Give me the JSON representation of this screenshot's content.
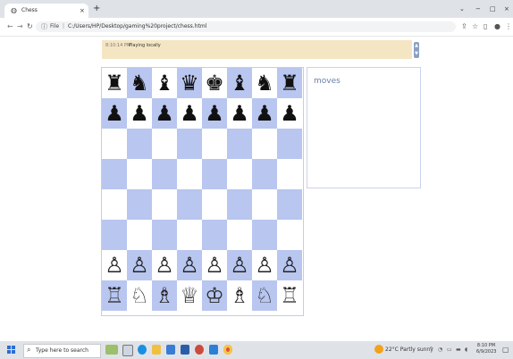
{
  "browser": {
    "tab_title": "Chess",
    "tab_icon": "globe-icon",
    "new_tab_glyph": "+",
    "url_prefix": "File",
    "url": "C:/Users/HP/Desktop/gaming%20project/chess.html",
    "controls": {
      "minimize": "−",
      "maximize": "□",
      "close": "×",
      "tabs_down": "⌄"
    }
  },
  "status": {
    "time": "8:10:14 PM",
    "message": "Playing locally"
  },
  "moves_panel": {
    "label": "moves"
  },
  "board": {
    "light_color": "#ffffff",
    "dark_color": "#b8c6f0",
    "rows": [
      [
        "♜",
        "♞",
        "♝",
        "♛",
        "♚",
        "♝",
        "♞",
        "♜"
      ],
      [
        "♟",
        "♟",
        "♟",
        "♟",
        "♟",
        "♟",
        "♟",
        "♟"
      ],
      [
        "",
        "",
        "",
        "",
        "",
        "",
        "",
        ""
      ],
      [
        "",
        "",
        "",
        "",
        "",
        "",
        "",
        ""
      ],
      [
        "",
        "",
        "",
        "",
        "",
        "",
        "",
        ""
      ],
      [
        "",
        "",
        "",
        "",
        "",
        "",
        "",
        ""
      ],
      [
        "♙",
        "♙",
        "♙",
        "♙",
        "♙",
        "♙",
        "♙",
        "♙"
      ],
      [
        "♖",
        "♘",
        "♗",
        "♕",
        "♔",
        "♗",
        "♘",
        "♖"
      ]
    ]
  },
  "taskbar": {
    "search_placeholder": "Type here to search",
    "weather": "22°C  Partly sunny",
    "time": "8:10 PM",
    "date": "6/9/2023"
  }
}
